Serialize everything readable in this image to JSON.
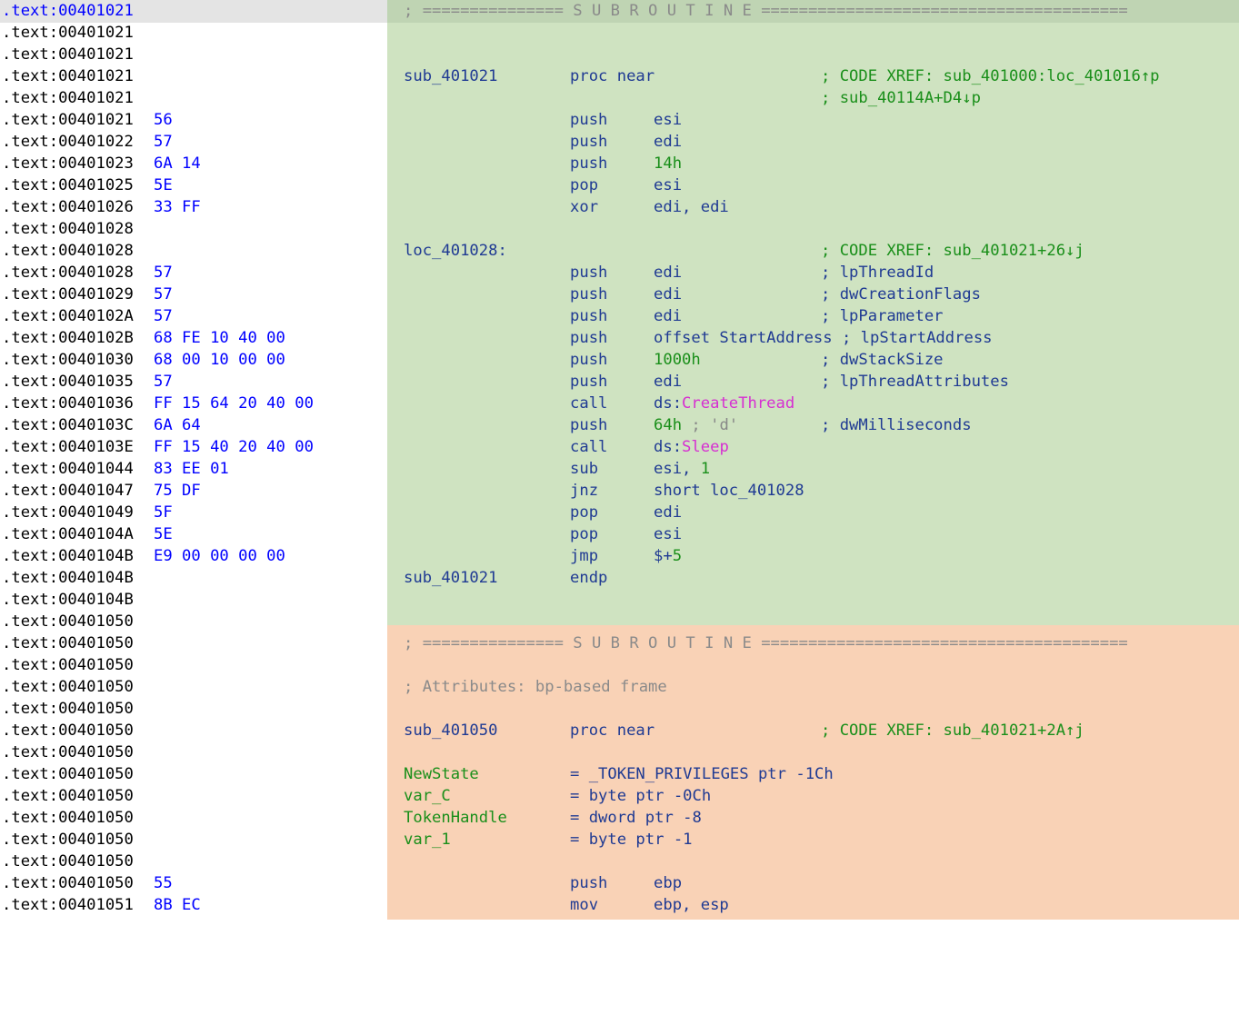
{
  "colors": {
    "function_bg_1": "#cfe3c1",
    "function_bg_2": "#f9d2b6",
    "address_text": "#000000",
    "bytes_text": "#0000ff",
    "code_text": "#1f3a93",
    "xref_and_numbers": "#1a8f1a",
    "api_names": "#d62fd1"
  },
  "rows": {
    "r0": {
      "addr": ".text:00401021",
      "sep": "; =============== S U B R O U T I N E ======================================="
    },
    "r1": {
      "addr": ".text:00401021"
    },
    "r2": {
      "addr": ".text:00401021"
    },
    "r3": {
      "addr": ".text:00401021",
      "label": "sub_401021",
      "mnemonic": "proc near",
      "comment": "; CODE XREF: sub_401000:loc_401016↑p"
    },
    "r4": {
      "addr": ".text:00401021",
      "comment": "; sub_40114A+D4↓p"
    },
    "r5": {
      "addr": ".text:00401021",
      "bytes": "56",
      "mnemonic": "push",
      "operand": "esi"
    },
    "r6": {
      "addr": ".text:00401022",
      "bytes": "57",
      "mnemonic": "push",
      "operand": "edi"
    },
    "r7": {
      "addr": ".text:00401023",
      "bytes": "6A 14",
      "mnemonic": "push",
      "operand_num": "14h"
    },
    "r8": {
      "addr": ".text:00401025",
      "bytes": "5E",
      "mnemonic": "pop",
      "operand": "esi"
    },
    "r9": {
      "addr": ".text:00401026",
      "bytes": "33 FF",
      "mnemonic": "xor",
      "operand": "edi, edi"
    },
    "r10": {
      "addr": ".text:00401028"
    },
    "r11": {
      "addr": ".text:00401028",
      "label": "loc_401028:",
      "comment": "; CODE XREF: sub_401021+26↓j"
    },
    "r12": {
      "addr": ".text:00401028",
      "bytes": "57",
      "mnemonic": "push",
      "operand": "edi",
      "comment": "; lpThreadId"
    },
    "r13": {
      "addr": ".text:00401029",
      "bytes": "57",
      "mnemonic": "push",
      "operand": "edi",
      "comment": "; dwCreationFlags"
    },
    "r14": {
      "addr": ".text:0040102A",
      "bytes": "57",
      "mnemonic": "push",
      "operand": "edi",
      "comment": "; lpParameter"
    },
    "r15": {
      "addr": ".text:0040102B",
      "bytes": "68 FE 10 40 00",
      "mnemonic": "push",
      "operand": "offset StartAddress ; lpStartAddress"
    },
    "r16": {
      "addr": ".text:00401030",
      "bytes": "68 00 10 00 00",
      "mnemonic": "push",
      "operand_num": "1000h",
      "comment": "; dwStackSize"
    },
    "r17": {
      "addr": ".text:00401035",
      "bytes": "57",
      "mnemonic": "push",
      "operand": "edi",
      "comment": "; lpThreadAttributes"
    },
    "r18": {
      "addr": ".text:00401036",
      "bytes": "FF 15 64 20 40 00",
      "mnemonic": "call",
      "operand_prefix": "ds:",
      "operand_api": "CreateThread"
    },
    "r19": {
      "addr": ".text:0040103C",
      "bytes": "6A 64",
      "mnemonic": "push",
      "operand_num": "64h",
      "operand_char": " ; 'd'",
      "comment": "; dwMilliseconds"
    },
    "r20": {
      "addr": ".text:0040103E",
      "bytes": "FF 15 40 20 40 00",
      "mnemonic": "call",
      "operand_prefix": "ds:",
      "operand_api": "Sleep"
    },
    "r21": {
      "addr": ".text:00401044",
      "bytes": "83 EE 01",
      "mnemonic": "sub",
      "operand": "esi, ",
      "operand_num": "1"
    },
    "r22": {
      "addr": ".text:00401047",
      "bytes": "75 DF",
      "mnemonic": "jnz",
      "operand": "short loc_401028"
    },
    "r23": {
      "addr": ".text:00401049",
      "bytes": "5F",
      "mnemonic": "pop",
      "operand": "edi"
    },
    "r24": {
      "addr": ".text:0040104A",
      "bytes": "5E",
      "mnemonic": "pop",
      "operand": "esi"
    },
    "r25": {
      "addr": ".text:0040104B",
      "bytes": "E9 00 00 00 00",
      "mnemonic": "jmp",
      "operand": "$+",
      "operand_num": "5"
    },
    "r26": {
      "addr": ".text:0040104B",
      "label": "sub_401021",
      "mnemonic": "endp"
    },
    "r27": {
      "addr": ".text:0040104B"
    },
    "r28": {
      "addr": ".text:00401050"
    },
    "r29": {
      "addr": ".text:00401050",
      "sep": "; =============== S U B R O U T I N E ======================================="
    },
    "r30": {
      "addr": ".text:00401050"
    },
    "r31": {
      "addr": ".text:00401050",
      "attr": "; Attributes: bp-based frame"
    },
    "r32": {
      "addr": ".text:00401050"
    },
    "r33": {
      "addr": ".text:00401050",
      "label": "sub_401050",
      "mnemonic": "proc near",
      "comment": "; CODE XREF: sub_401021+2A↑j"
    },
    "r34": {
      "addr": ".text:00401050"
    },
    "r35": {
      "addr": ".text:00401050",
      "var_name": "NewState",
      "var_def": "= _TOKEN_PRIVILEGES ptr -1Ch"
    },
    "r36": {
      "addr": ".text:00401050",
      "var_name": "var_C",
      "var_def": "= byte ptr -0Ch"
    },
    "r37": {
      "addr": ".text:00401050",
      "var_name": "TokenHandle",
      "var_def": "= dword ptr -8"
    },
    "r38": {
      "addr": ".text:00401050",
      "var_name": "var_1",
      "var_def": "= byte ptr -1"
    },
    "r39": {
      "addr": ".text:00401050"
    },
    "r40": {
      "addr": ".text:00401050",
      "bytes": "55",
      "mnemonic": "push",
      "operand": "ebp"
    },
    "r41": {
      "addr": ".text:00401051",
      "bytes": "8B EC",
      "mnemonic": "mov",
      "operand": "ebp, esp"
    }
  }
}
